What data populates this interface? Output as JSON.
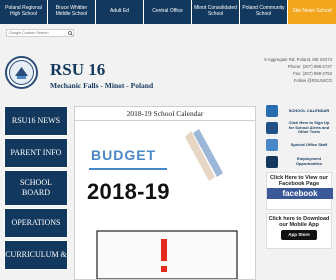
{
  "nav": {
    "tabs": [
      {
        "label": "Poland Regional High School"
      },
      {
        "label": "Bruce Whittier Middle School"
      },
      {
        "label": "Adult Ed"
      },
      {
        "label": "Central Office"
      },
      {
        "label": "Minot Consolidated School"
      },
      {
        "label": "Poland Community School"
      },
      {
        "label": "Site News School"
      }
    ]
  },
  "search": {
    "placeholder": "Google Custom Search"
  },
  "header": {
    "title": "RSU 16",
    "subtitle": "Mechanic Falls - Minot - Poland",
    "contact": {
      "address": "5 Aggregate Rd, Poland, ME 04274",
      "phone": "Phone: (207) 998-2727",
      "fax": "Fax: (207) 998-2753",
      "social": "Follow @RSU16CO"
    }
  },
  "menu": {
    "items": [
      {
        "label": "RSU16 NEWS"
      },
      {
        "label": "PARENT INFO"
      },
      {
        "label": "SCHOOL BOARD"
      },
      {
        "label": "OPERATIONS"
      },
      {
        "label": "CURRICULUM &"
      }
    ]
  },
  "main": {
    "panel_title": "2018-19 School Calendar",
    "budget_text": "BUDGET",
    "year_text": "2018-19"
  },
  "sidebar": {
    "school_calendar": "SCHOOL CALENDAR",
    "click_here": "Click Here to Sign Up for School Alerts and Other Texts",
    "special_office": "Special Office Staff",
    "employment": "Employment Opportunities",
    "facebook_text": "Click Here to View our Facebook Page",
    "facebook_badge": "facebook",
    "app_text": "Click here to Download our Mobile App",
    "app_badge": "App Store"
  },
  "colors": {
    "navy": "#13385e",
    "gold": "#f3a51b",
    "accent_blue": "#4a87c6",
    "red": "#e32a1d"
  }
}
